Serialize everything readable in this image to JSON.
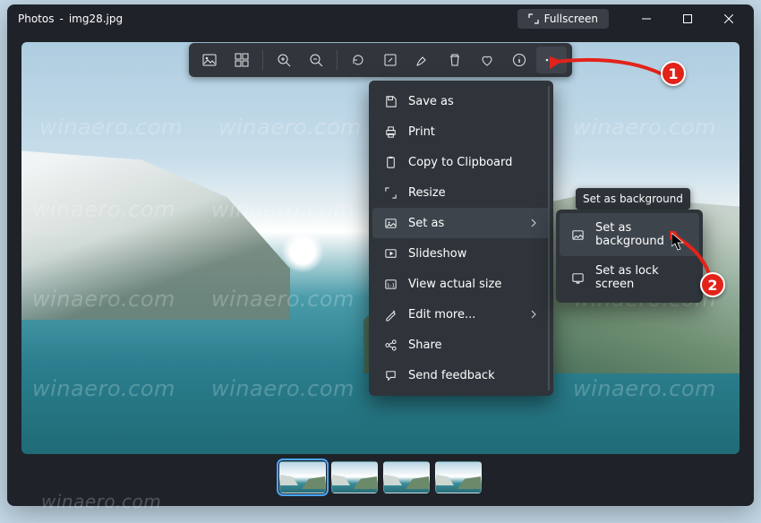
{
  "titlebar": {
    "app": "Photos",
    "file": "img28.jpg",
    "fullscreen_label": "Fullscreen"
  },
  "toolbar": {
    "items": [
      "image-icon",
      "crop-icon",
      "zoom-in-icon",
      "zoom-out-icon",
      "rotate-icon",
      "edit-icon",
      "draw-icon",
      "delete-icon",
      "favorite-icon",
      "info-icon",
      "more-icon"
    ]
  },
  "menu": {
    "items": [
      {
        "icon": "save-icon",
        "label": "Save as"
      },
      {
        "icon": "print-icon",
        "label": "Print"
      },
      {
        "icon": "clipboard-icon",
        "label": "Copy to Clipboard"
      },
      {
        "icon": "resize-icon",
        "label": "Resize"
      },
      {
        "icon": "setas-icon",
        "label": "Set as",
        "submenu": true,
        "highlight": true
      },
      {
        "icon": "slideshow-icon",
        "label": "Slideshow"
      },
      {
        "icon": "actualsize-icon",
        "label": "View actual size"
      },
      {
        "icon": "editmore-icon",
        "label": "Edit more...",
        "submenu": true
      },
      {
        "icon": "share-icon",
        "label": "Share"
      },
      {
        "icon": "feedback-icon",
        "label": "Send feedback"
      }
    ]
  },
  "submenu": {
    "items": [
      {
        "icon": "background-icon",
        "label": "Set as background",
        "highlight": true
      },
      {
        "icon": "lockscreen-icon",
        "label": "Set as lock screen"
      }
    ]
  },
  "tooltip": {
    "text": "Set as background"
  },
  "callouts": {
    "one": "1",
    "two": "2"
  },
  "watermark": "winaero.com",
  "filmstrip": {
    "count": 4,
    "selected": 0
  }
}
